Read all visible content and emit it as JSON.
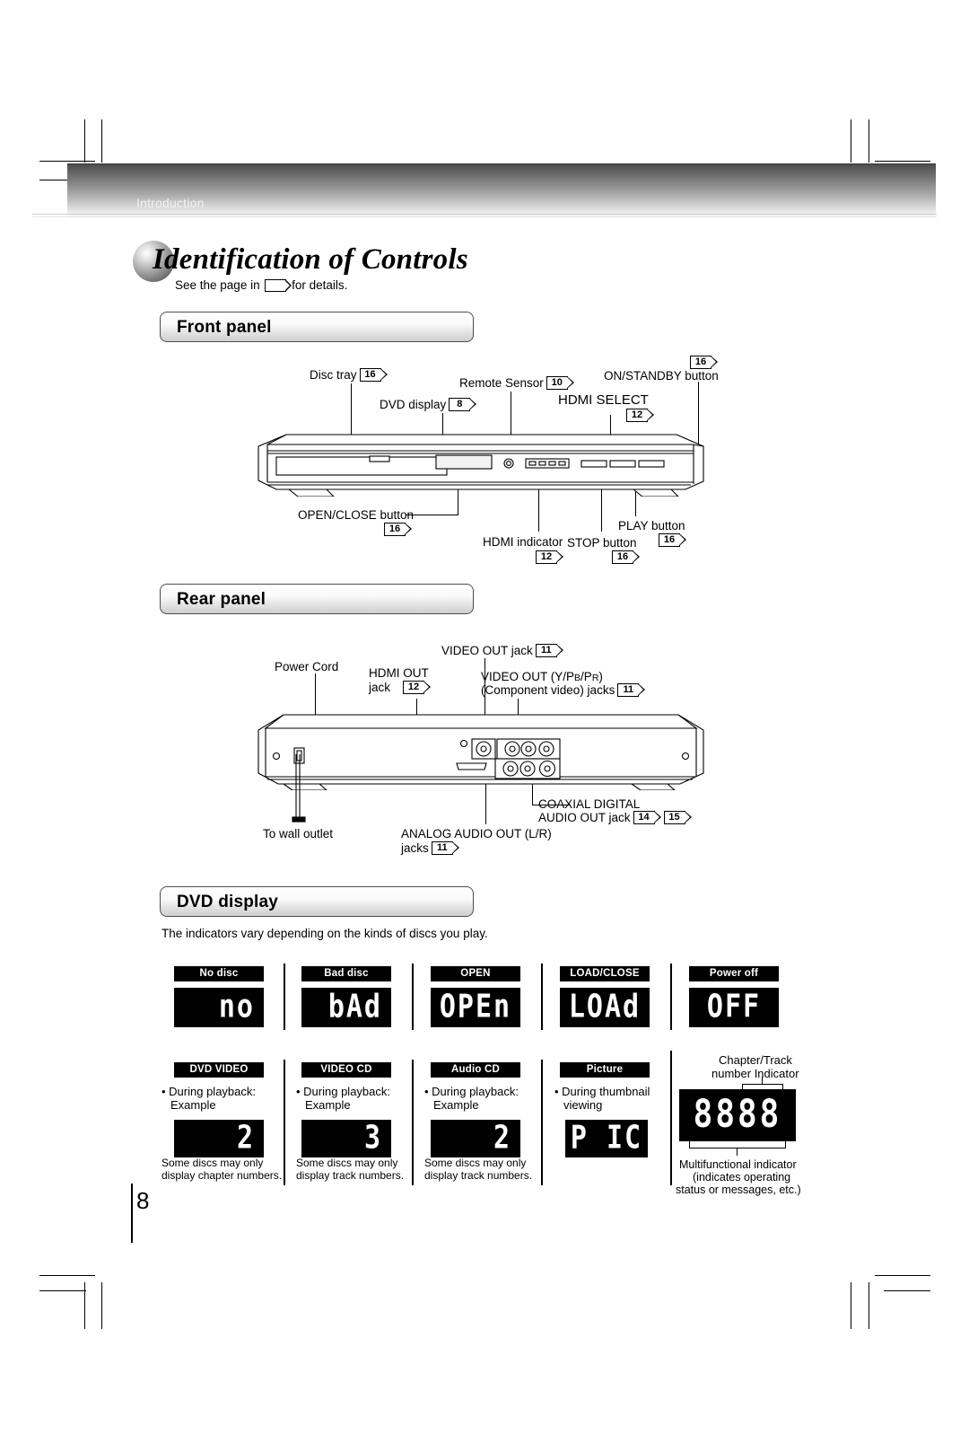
{
  "page": {
    "breadcrumb": "Introduction",
    "title": "Identification of Controls",
    "subtitle_before": "See the page in",
    "subtitle_after": "for details.",
    "page_number": "8"
  },
  "sections": {
    "front_panel": {
      "heading": "Front panel"
    },
    "rear_panel": {
      "heading": "Rear panel"
    },
    "dvd_display": {
      "heading": "DVD display",
      "intro": "The indicators vary depending on the kinds of discs you play."
    }
  },
  "front_panel_labels": [
    {
      "text": "Disc tray",
      "ref": "16"
    },
    {
      "text": "DVD display",
      "ref": "8"
    },
    {
      "text": "Remote Sensor",
      "ref": "10"
    },
    {
      "text": "HDMI SELECT",
      "ref": "12"
    },
    {
      "text": "ON/STANDBY button",
      "ref": "16"
    },
    {
      "text": "OPEN/CLOSE button",
      "ref": "16"
    },
    {
      "text": "HDMI indicator",
      "ref": "12"
    },
    {
      "text": "STOP button",
      "ref": "16"
    },
    {
      "text": "PLAY button",
      "ref": "16"
    }
  ],
  "rear_panel_labels": [
    {
      "text": "Power Cord",
      "ref": ""
    },
    {
      "text": "HDMI OUT",
      "text2": "jack",
      "ref": "12"
    },
    {
      "text": "VIDEO OUT jack",
      "ref": "11"
    },
    {
      "text": "VIDEO OUT (Y/PB/PR)",
      "text2": "(Component video) jacks",
      "ref": "11"
    },
    {
      "text": "COAXIAL DIGITAL",
      "text2": "AUDIO OUT jack",
      "ref": "14",
      "ref2": "15"
    },
    {
      "text": "ANALOG AUDIO OUT (L/R)",
      "text2": "jacks",
      "ref": "11"
    },
    {
      "text": "To wall outlet",
      "ref": ""
    }
  ],
  "display_row1": [
    {
      "badge": "No disc",
      "led": "no",
      "align": "right"
    },
    {
      "badge": "Bad disc",
      "led": "bAd",
      "align": "right"
    },
    {
      "badge": "OPEN",
      "led": "OPEn",
      "align": "center"
    },
    {
      "badge": "LOAD/CLOSE",
      "led": "LOAd",
      "align": "center"
    },
    {
      "badge": "Power off",
      "led": "OFF",
      "align": "center"
    }
  ],
  "display_row2": [
    {
      "badge": "DVD VIDEO",
      "note": "• During playback:",
      "note2": "Example",
      "led": "2",
      "align": "right",
      "caption": "Some discs may only",
      "caption2": "display chapter numbers."
    },
    {
      "badge": "VIDEO CD",
      "note": "• During playback:",
      "note2": "Example",
      "led": "3",
      "align": "right",
      "caption": "Some discs may only",
      "caption2": "display track numbers."
    },
    {
      "badge": "Audio CD",
      "note": "• During playback:",
      "note2": "Example",
      "led": "2",
      "align": "right",
      "caption": "Some discs may only",
      "caption2": "display track numbers."
    },
    {
      "badge": "Picture",
      "note": "• During thumbnail",
      "note2": "viewing",
      "led": "P IC",
      "align": "center",
      "caption": "",
      "caption2": ""
    }
  ],
  "indicator_panel": {
    "top_label1": "Chapter/Track",
    "top_label2": "number  Indicator",
    "led": "8888",
    "bottom_label1": "Multifunctional  indicator",
    "bottom_label2": "(indicates operating",
    "bottom_label3": "status or messages, etc.)"
  }
}
